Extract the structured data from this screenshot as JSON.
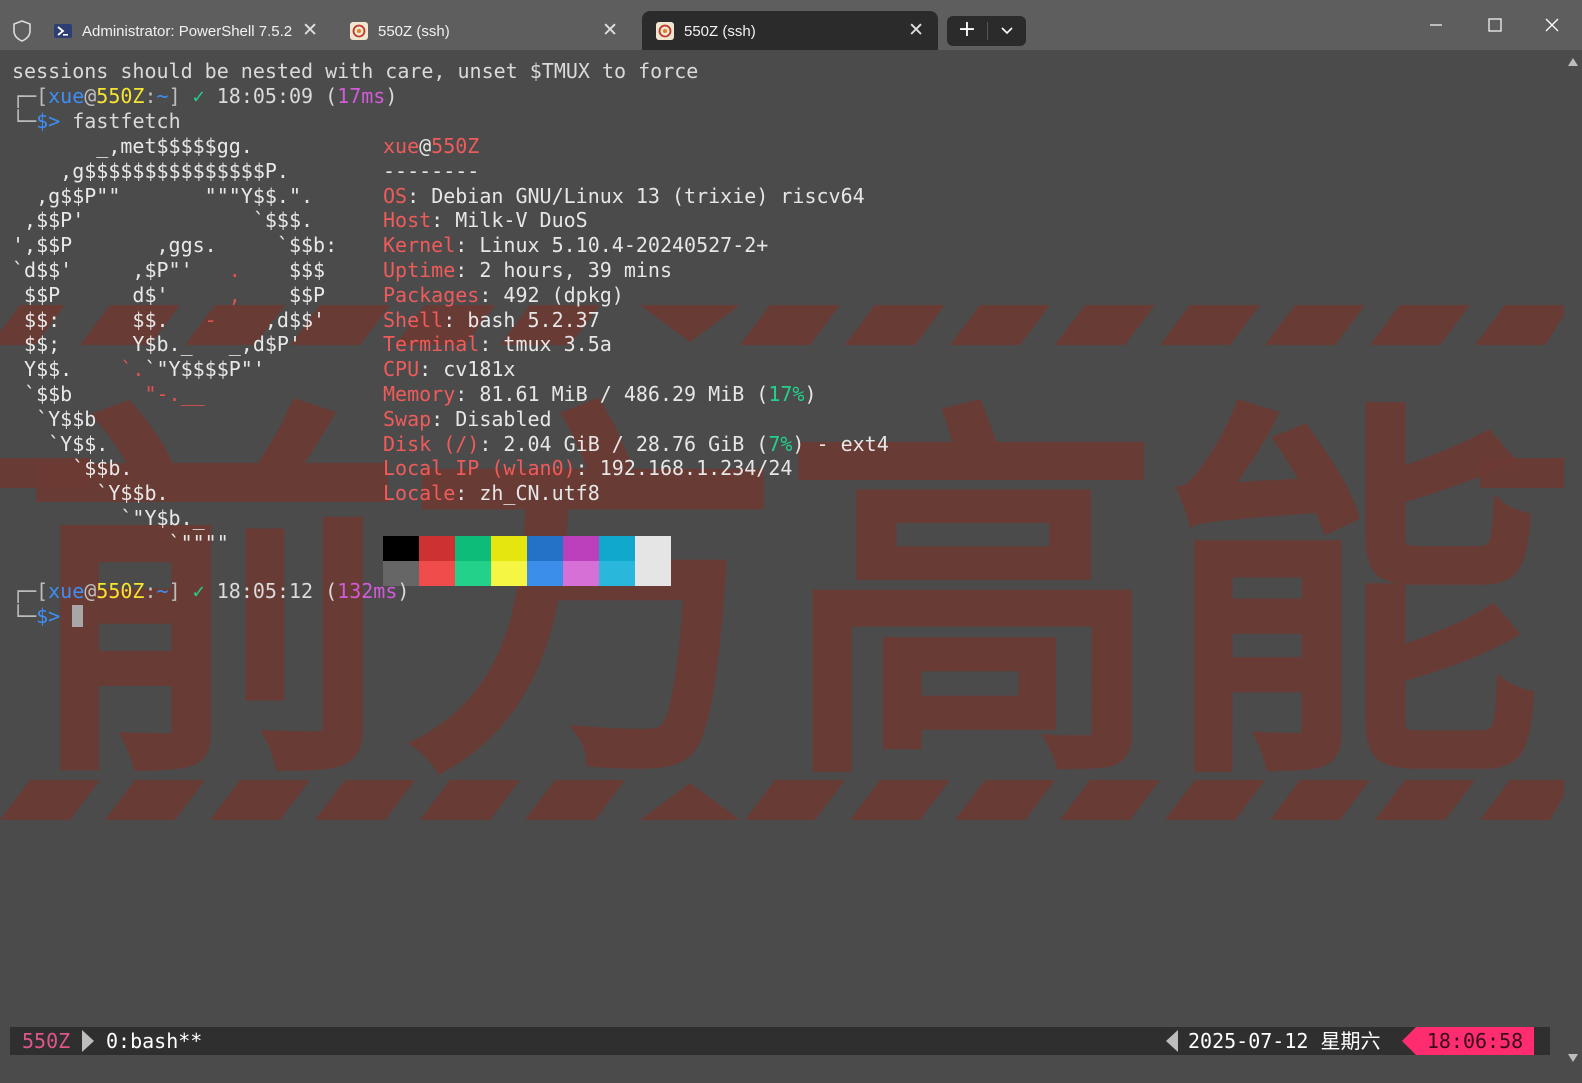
{
  "titlebar": {
    "tabs": [
      {
        "label": "Administrator: PowerShell 7.5.2",
        "icon": "powershell-icon",
        "active": false
      },
      {
        "label": "550Z (ssh)",
        "icon": "ssh-profile-icon",
        "active": false
      },
      {
        "label": "550Z (ssh)",
        "icon": "ssh-profile-icon",
        "active": true
      }
    ],
    "close_glyph": "✕",
    "new_tab_glyph": "+"
  },
  "terminal": {
    "warning_line": "sessions should be nested with care, unset $TMUX to force",
    "prompt1": {
      "user": "xue",
      "at": "@",
      "host": "550Z",
      "cwd": "~",
      "check": "✓",
      "time": "18:05:09",
      "duration": "17ms",
      "command": "fastfetch"
    },
    "prompt2": {
      "user": "xue",
      "at": "@",
      "host": "550Z",
      "cwd": "~",
      "check": "✓",
      "time": "18:05:12",
      "duration": "132ms"
    },
    "prompt_symbol": "$>",
    "fastfetch": {
      "title_user": "xue",
      "title_host": "550Z",
      "separator": "--------",
      "rows": [
        {
          "key": "OS",
          "value": "Debian GNU/Linux 13 (trixie) riscv64"
        },
        {
          "key": "Host",
          "value": "Milk-V DuoS"
        },
        {
          "key": "Kernel",
          "value": "Linux 5.10.4-20240527-2+"
        },
        {
          "key": "Uptime",
          "value": "2 hours, 39 mins"
        },
        {
          "key": "Packages",
          "value": "492 (dpkg)"
        },
        {
          "key": "Shell",
          "value": "bash 5.2.37"
        },
        {
          "key": "Terminal",
          "value": "tmux 3.5a"
        },
        {
          "key": "CPU",
          "value": "cv181x"
        },
        {
          "key": "Memory",
          "value": "81.61 MiB / 486.29 MiB (",
          "pct": "17%",
          "tail": ")"
        },
        {
          "key": "Swap",
          "value": "Disabled"
        },
        {
          "key": "Disk (/)",
          "value": "2.04 GiB / 28.76 GiB (",
          "pct": "7%",
          "tail": ") - ext4"
        },
        {
          "key": "Local IP (wlan0)",
          "value": "192.168.1.234/24"
        },
        {
          "key": "Locale",
          "value": "zh_CN.utf8"
        }
      ],
      "palette_top": [
        "#000000",
        "#cd3131",
        "#0dbc79",
        "#e5e510",
        "#2472c8",
        "#bc3fbc",
        "#11a8cd",
        "#e5e5e5"
      ],
      "palette_bottom": [
        "#666666",
        "#f14c4c",
        "#23d18b",
        "#f5f543",
        "#3b8eea",
        "#d670d6",
        "#29b8db",
        "#e5e5e5"
      ]
    },
    "watermark": "前方高能"
  },
  "tmux": {
    "session": "550Z",
    "window": "0:bash**",
    "date": "2025-07-12 星期六",
    "clock": "18:06:58"
  },
  "colors": {
    "accent": "#ff2d6f",
    "session": "#e0568a",
    "watermark": "#6d3a33"
  }
}
